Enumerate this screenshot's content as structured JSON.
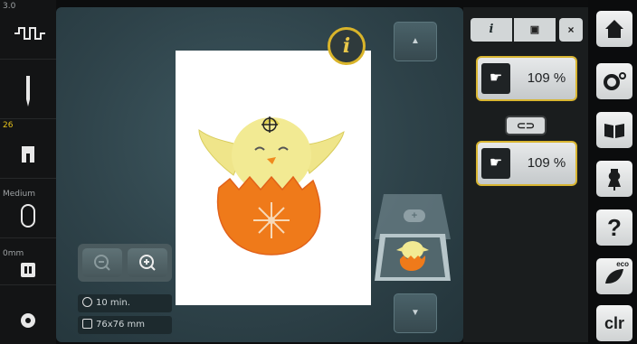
{
  "status_bar": {
    "speed_value": "3.0",
    "needle_icon": "needle-icon",
    "presser_foot_value": "26",
    "tension_value": "Medium",
    "feed_dog_value": "0mm",
    "hoop_icon": "hoop-icon"
  },
  "workspace": {
    "info_button_label": "i",
    "time_value": "10 min.",
    "size_value": "76x76 mm",
    "zoom_out_icon": "zoom-out-icon",
    "zoom_in_icon": "zoom-in-icon",
    "colors": {
      "accent": "#d8b531",
      "chick_yellow": "#efe58a",
      "egg_orange": "#ef7a1a"
    }
  },
  "edit_panel": {
    "tab_info_label": "i",
    "close_label": "×",
    "scale_width_value": "109 %",
    "scale_height_value": "109 %"
  },
  "system_bar": {
    "home_icon": "home-icon",
    "settings_icon": "settings-icon",
    "tutorial_icon": "book-icon",
    "consultant_icon": "dress-form-icon",
    "help_label": "?",
    "eco_label": "eco",
    "clear_label": "clr"
  }
}
